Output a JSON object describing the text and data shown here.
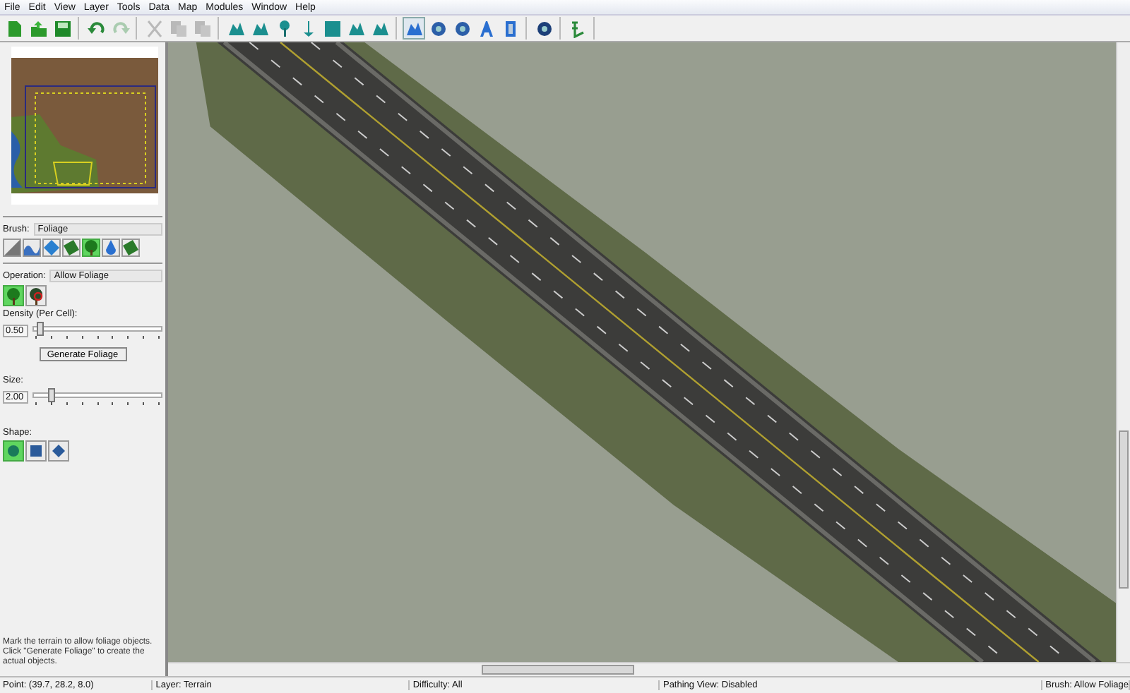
{
  "menu": [
    "File",
    "Edit",
    "View",
    "Layer",
    "Tools",
    "Data",
    "Map",
    "Modules",
    "Window",
    "Help"
  ],
  "toolbar": [
    [
      {
        "disabled": false,
        "selected": false
      },
      {
        "disabled": false,
        "selected": false
      },
      {
        "disabled": false,
        "selected": false
      }
    ],
    [
      {
        "disabled": false,
        "selected": false
      },
      {
        "disabled": true,
        "selected": false
      }
    ],
    [
      {
        "disabled": true,
        "selected": false
      },
      {
        "disabled": true,
        "selected": false
      },
      {
        "disabled": true,
        "selected": false
      }
    ],
    [
      {
        "disabled": false,
        "selected": false
      },
      {
        "disabled": false,
        "selected": false
      },
      {
        "disabled": false,
        "selected": false
      },
      {
        "disabled": false,
        "selected": false
      },
      {
        "disabled": false,
        "selected": false
      },
      {
        "disabled": false,
        "selected": false
      },
      {
        "disabled": false,
        "selected": false
      }
    ],
    [
      {
        "disabled": false,
        "selected": true
      },
      {
        "disabled": false,
        "selected": false
      },
      {
        "disabled": false,
        "selected": false
      },
      {
        "disabled": false,
        "selected": false
      },
      {
        "disabled": false,
        "selected": false
      }
    ],
    [
      {
        "disabled": false,
        "selected": false
      }
    ],
    [
      {
        "disabled": false,
        "selected": false
      }
    ]
  ],
  "brush": {
    "label": "Brush:",
    "value": "Foliage",
    "tools": [
      {
        "selected": false
      },
      {
        "selected": false
      },
      {
        "selected": false
      },
      {
        "selected": false
      },
      {
        "selected": true
      },
      {
        "selected": false
      },
      {
        "selected": false
      }
    ]
  },
  "operation": {
    "label": "Operation:",
    "value": "Allow Foliage",
    "tools": [
      {
        "selected": true
      },
      {
        "selected": false
      }
    ]
  },
  "density": {
    "label": "Density (Per Cell):",
    "value": "0.50",
    "level": 0.05
  },
  "generate_button": "Generate Foliage",
  "size": {
    "label": "Size:",
    "value": "2.00",
    "level": 0.14
  },
  "shape": {
    "label": "Shape:",
    "tools": [
      {
        "selected": true
      },
      {
        "selected": false
      },
      {
        "selected": false
      }
    ]
  },
  "hint": "Mark the terrain to allow foliage objects. Click \"Generate Foliage\" to create the actual objects.",
  "status_bar": [
    "Point: (39.7, 28.2, 8.0)",
    "Layer: Terrain",
    "Difficulty: All",
    "Pathing View: Disabled",
    "Brush: Allow Foliage"
  ]
}
